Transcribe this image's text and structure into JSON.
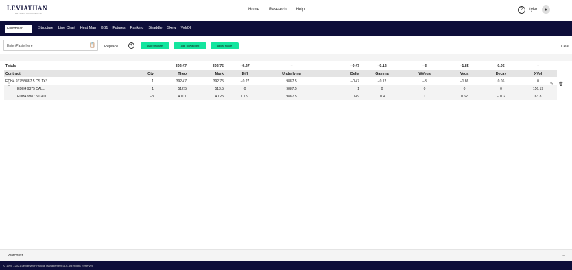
{
  "brand": {
    "name": "LEVIATHAN",
    "tagline": "TRADING WITH INSIGHT"
  },
  "topnav": [
    "Home",
    "Research",
    "Help"
  ],
  "user": {
    "name": "tyler",
    "help_icon": "question-circle-icon",
    "avatar_icon": "user-icon",
    "menu_icon": "more-dots-icon"
  },
  "product_select": "Eurodollar",
  "tabs": [
    "Structure",
    "Line Chart",
    "Heat Map",
    "BB1",
    "Futures",
    "Ranking",
    "Straddle",
    "Skew",
    "Vol/OI"
  ],
  "input": {
    "placeholder": "Enter/Paste here"
  },
  "replace_label": "Replace",
  "buttons": {
    "add_structure": "Add Structure",
    "add_watchlist": "Add To Watchlist",
    "adjust_future": "Adjust Future",
    "clear": "Clear"
  },
  "table": {
    "totals_label": "Totals",
    "totals": [
      "",
      "392.47",
      "392.75",
      "−0.27",
      "−",
      "−0.47",
      "−0.12",
      "−3",
      "−1.85",
      "0.06",
      "−"
    ],
    "headers": [
      "Contract",
      "Qty",
      "Theo",
      "Mark",
      "Diff",
      "Underlying",
      "Delta",
      "Gamma",
      "WVega",
      "Vega",
      "Decay",
      "XVol"
    ],
    "rows": [
      [
        "EDH4 9375/9887.5 CS 1X3",
        "1",
        "392.47",
        "392.75",
        "−0.27",
        "9887.5",
        "−0.47",
        "−0.12",
        "−3",
        "−1.86",
        "0.06",
        "0"
      ],
      [
        "EDH4 9375 CALL",
        "1",
        "512.5",
        "513.5",
        "0",
        "9887.5",
        "1",
        "0",
        "0",
        "0",
        "0",
        "156.19"
      ],
      [
        "EDH4 9887.5 CALL",
        "−3",
        "40.01",
        "40.25",
        "0.09",
        "9887.5",
        "0.49",
        "0.04",
        "1",
        "0.62",
        "−0.02",
        "63.8"
      ]
    ]
  },
  "watchlist_label": "Watchlist",
  "footer": "© 1995 - 2021 Leviathan Financial Management LLC. All Rights Reserved",
  "colors": {
    "navy": "#0e0e3a",
    "accent_green": "#14e59e"
  }
}
